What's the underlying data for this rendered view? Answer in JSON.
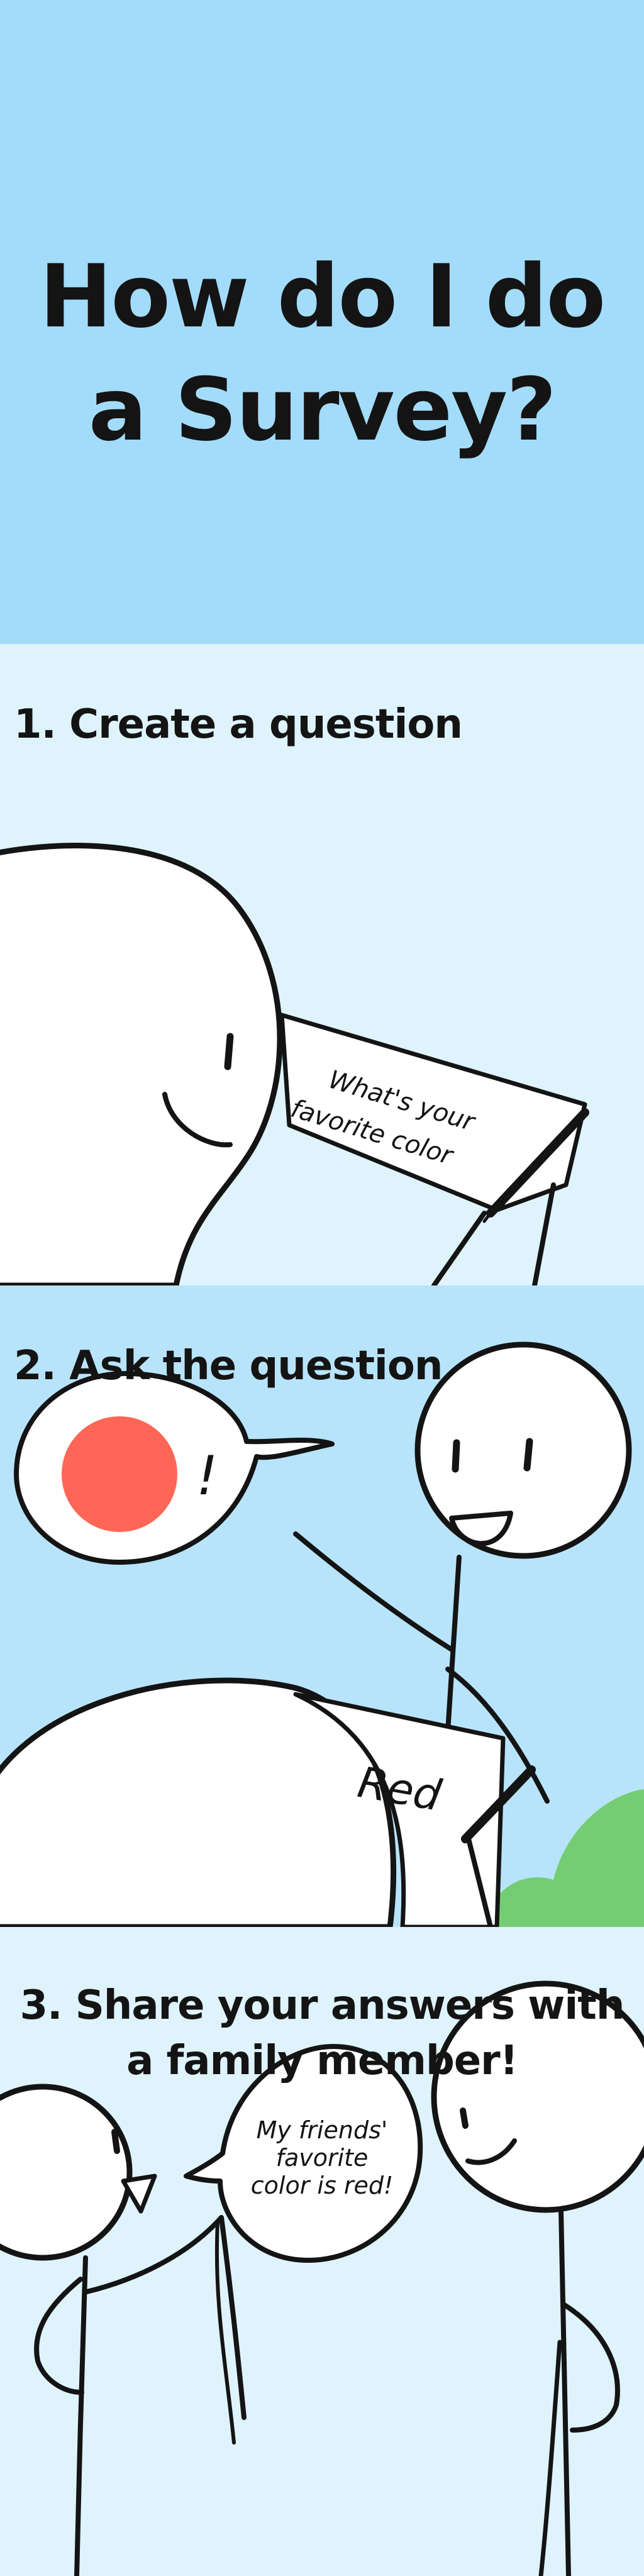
{
  "title": {
    "line1": "How do I do",
    "line2": "a Survey?"
  },
  "step1": {
    "heading": "1. Create a question",
    "paper_line1": "What's your",
    "paper_line2": "favorite color"
  },
  "step2": {
    "heading": "2. Ask the question",
    "exclaim": "!",
    "paper_answer": "Red"
  },
  "step3": {
    "heading_line1": "3. Share your answers with",
    "heading_line2": "a family member!",
    "bubble_line1": "My friends'",
    "bubble_line2": "favorite",
    "bubble_line3": "color is red!"
  },
  "colors": {
    "hero_bg": "#a3dcfb",
    "panel_light": "#dff3fd",
    "panel_mid": "#b8e4fb",
    "red_dot": "#ff6656",
    "bush": "#75cd73",
    "ink": "#141414"
  }
}
